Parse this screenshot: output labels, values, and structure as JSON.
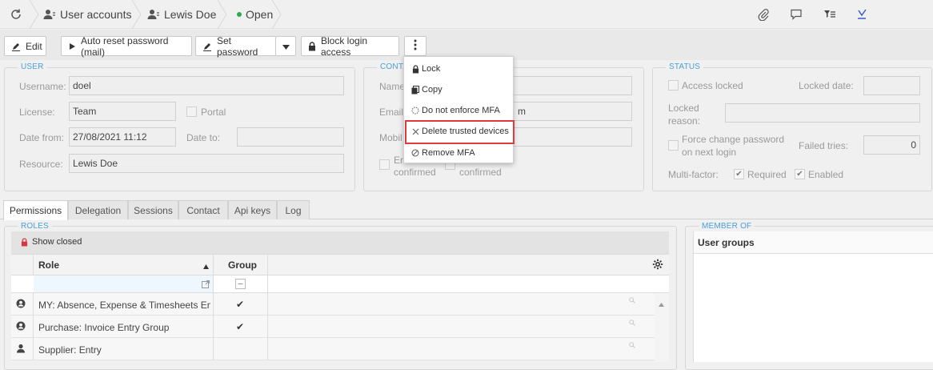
{
  "breadcrumb": {
    "items": [
      {
        "label": "User accounts",
        "icon": "user-accounts-icon"
      },
      {
        "label": "Lewis Doe",
        "icon": "user-icon"
      },
      {
        "label": "Open",
        "icon": "status-dot-icon",
        "color": "#2eaa4a"
      }
    ]
  },
  "toolbar": {
    "edit_label": "Edit",
    "auto_reset_label": "Auto reset password (mail)",
    "set_password_label": "Set password",
    "block_login_label": "Block login access"
  },
  "user_section": {
    "legend": "USER",
    "username_label": "Username:",
    "username_value": "doel",
    "license_label": "License:",
    "license_value": "Team",
    "portal_label": "Portal",
    "date_from_label": "Date from:",
    "date_from_value": "27/08/2021 11:12",
    "date_to_label": "Date to:",
    "date_to_value": "",
    "resource_label": "Resource:",
    "resource_value": "Lewis Doe"
  },
  "contact_section": {
    "legend": "CONTA",
    "name_label": "Name",
    "email_label": "Email:",
    "email_value_visible": "m",
    "mobile_label": "Mobil",
    "email_confirmed_a": "Em",
    "email_confirmed_b": "confirmed",
    "mobile_confirmed": "confirmed"
  },
  "status_section": {
    "legend": "STATUS",
    "access_locked_label": "Access locked",
    "locked_date_label": "Locked date:",
    "locked_reason_label_1": "Locked",
    "locked_reason_label_2": "reason:",
    "force_change_label_1": "Force change password",
    "force_change_label_2": "on next login",
    "failed_tries_label": "Failed tries:",
    "failed_tries_value": "0",
    "multifactor_label": "Multi-factor:",
    "required_label": "Required",
    "enabled_label": "Enabled"
  },
  "menu": {
    "items": [
      {
        "label": "Lock",
        "icon": "lock-icon"
      },
      {
        "label": "Copy",
        "icon": "copy-icon"
      },
      {
        "label": "Do not enforce MFA",
        "icon": "dashed-circle-icon"
      },
      {
        "label": "Delete trusted devices",
        "icon": "close-icon"
      },
      {
        "label": "Remove MFA",
        "icon": "no-entry-icon"
      }
    ],
    "highlight_color": "#e0393e"
  },
  "tabs": [
    "Permissions",
    "Delegation",
    "Sessions",
    "Contact",
    "Api keys",
    "Log"
  ],
  "roles": {
    "legend": "ROLES",
    "show_closed_label": "Show closed",
    "col_role": "Role",
    "col_group": "Group",
    "rows": [
      {
        "name": "MY: Absence, Expense & Timesheets En...",
        "group": "✔",
        "icon": "user-circle-icon"
      },
      {
        "name": "Purchase: Invoice Entry Group",
        "group": "✔",
        "icon": "user-circle-icon"
      },
      {
        "name": "Supplier: Entry",
        "group": "",
        "icon": "person-icon"
      }
    ]
  },
  "member_of": {
    "legend": "MEMBER OF",
    "header": "User groups"
  },
  "colors": {
    "accent": "#4a9fd8",
    "lock_red": "#d9363e"
  }
}
